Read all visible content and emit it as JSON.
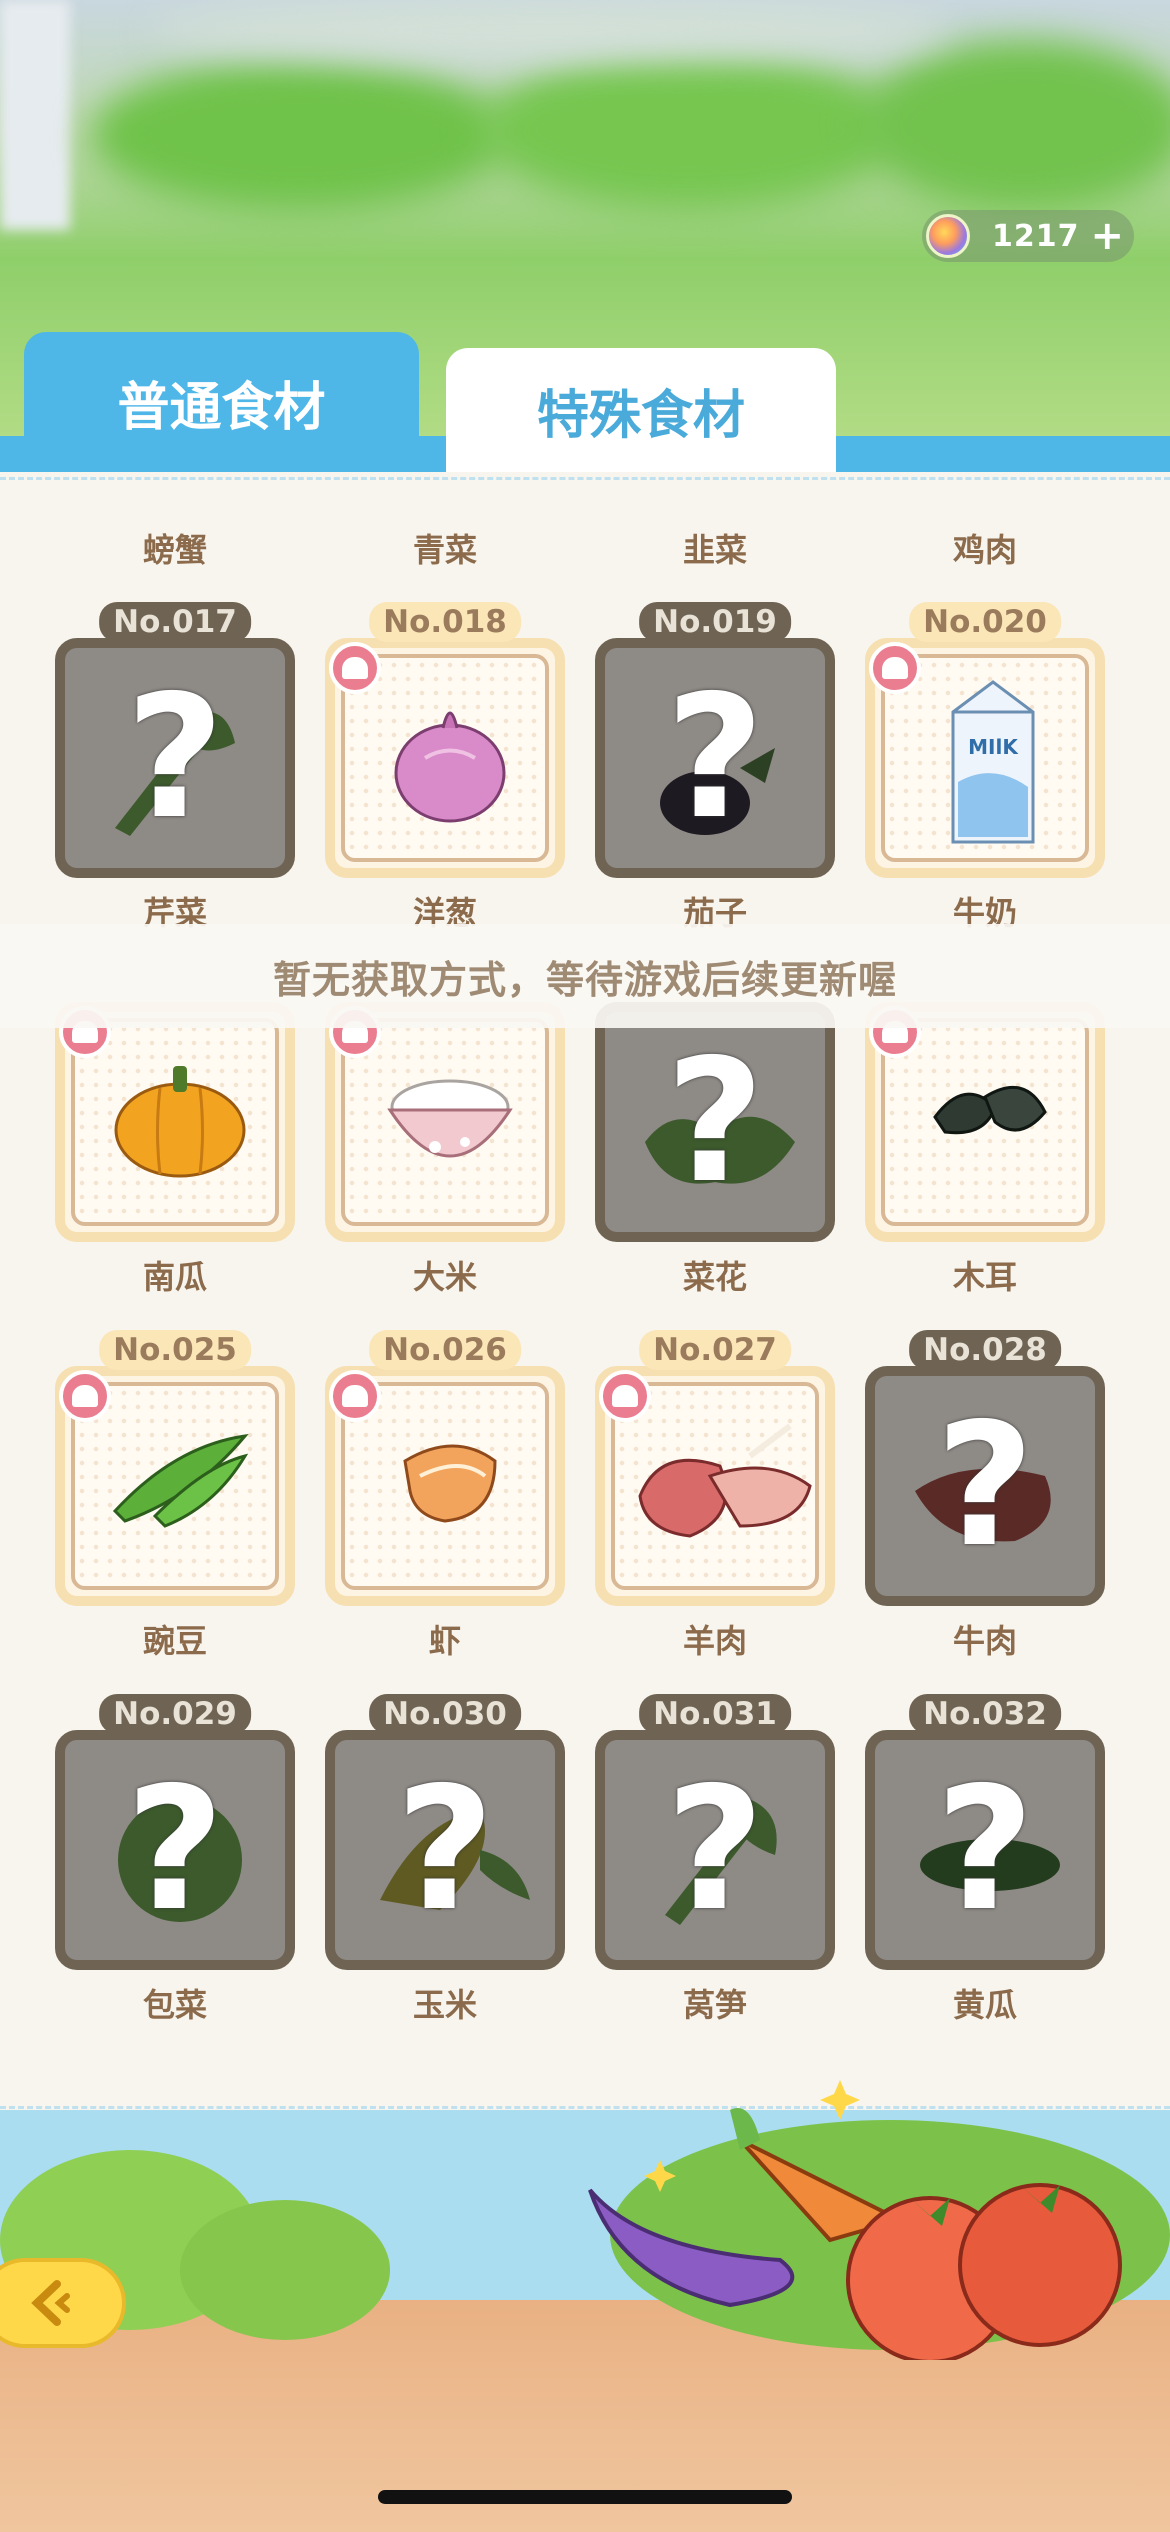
{
  "currency": {
    "amount": "1217",
    "plus_label": "+",
    "gem_icon": "rainbow-gem-icon"
  },
  "tabs": [
    {
      "label": "普通食材",
      "active": true
    },
    {
      "label": "特殊食材",
      "active": false
    }
  ],
  "top_row_names": [
    "螃蟹",
    "青菜",
    "韭菜",
    "鸡肉"
  ],
  "rows": [
    {
      "items": [
        {
          "no": "No.017",
          "name": "芹菜",
          "unlocked": false
        },
        {
          "no": "No.018",
          "name": "洋葱",
          "unlocked": true,
          "icon": "onion-icon"
        },
        {
          "no": "No.019",
          "name": "茄子",
          "unlocked": false
        },
        {
          "no": "No.020",
          "name": "牛奶",
          "unlocked": true,
          "icon": "milk-carton-icon",
          "icon_text": "MIlK"
        }
      ]
    },
    {
      "items": [
        {
          "no": "",
          "name": "南瓜",
          "unlocked": true,
          "icon": "pumpkin-icon"
        },
        {
          "no": "",
          "name": "大米",
          "unlocked": true,
          "icon": "rice-bowl-icon"
        },
        {
          "no": "",
          "name": "菜花",
          "unlocked": false
        },
        {
          "no": "",
          "name": "木耳",
          "unlocked": true,
          "icon": "wood-ear-icon"
        }
      ]
    },
    {
      "items": [
        {
          "no": "No.025",
          "name": "豌豆",
          "unlocked": true,
          "icon": "pea-pod-icon"
        },
        {
          "no": "No.026",
          "name": "虾",
          "unlocked": true,
          "icon": "shrimp-icon"
        },
        {
          "no": "No.027",
          "name": "羊肉",
          "unlocked": true,
          "icon": "lamb-meat-icon"
        },
        {
          "no": "No.028",
          "name": "牛肉",
          "unlocked": false
        }
      ]
    },
    {
      "items": [
        {
          "no": "No.029",
          "name": "包菜",
          "unlocked": false
        },
        {
          "no": "No.030",
          "name": "玉米",
          "unlocked": false
        },
        {
          "no": "No.031",
          "name": "莴笋",
          "unlocked": false
        },
        {
          "no": "No.032",
          "name": "黄瓜",
          "unlocked": false
        }
      ]
    }
  ],
  "locked_mark": "?",
  "notice": "暂无获取方式，等待游戏后续更新喔",
  "back_button": {
    "icon": "back-arrow-icon"
  },
  "colors": {
    "tab_blue": "#4fb6e8",
    "brown_text": "#8b6b4c",
    "locked_card": "#6f6453",
    "found_border": "#f6dfb0"
  }
}
